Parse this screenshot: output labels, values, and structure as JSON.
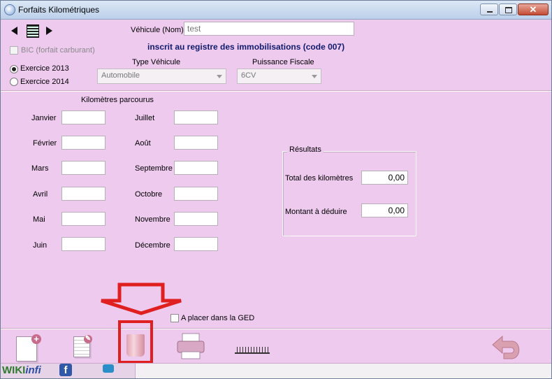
{
  "window": {
    "title": "Forfaits Kilométriques",
    "min_glyph": "",
    "max_glyph": "",
    "close_glyph": "✕"
  },
  "vehicule": {
    "label": "Véhicule (Nom)",
    "value": "test",
    "registry_text": "inscrit au registre des immobilisations (code 007)"
  },
  "options": {
    "bic_label": "BIC (forfait carburant)",
    "bic_checked": false,
    "exercices": [
      {
        "label": "Exercice 2013",
        "selected": true
      },
      {
        "label": "Exercice 2014",
        "selected": false
      }
    ]
  },
  "type_vehicule": {
    "label": "Type Véhicule",
    "value": "Automobile"
  },
  "puissance": {
    "label": "Puissance Fiscale",
    "value": "6CV"
  },
  "kilometres": {
    "section_label": "Kilomètres parcourus",
    "months_left": [
      "Janvier",
      "Février",
      "Mars",
      "Avril",
      "Mai",
      "Juin"
    ],
    "months_right": [
      "Juillet",
      "Août",
      "Septembre",
      "Octobre",
      "Novembre",
      "Décembre"
    ]
  },
  "resultats": {
    "title": "Résultats",
    "total_label": "Total des kilomètres",
    "total_value": "0,00",
    "montant_label": "Montant à déduire",
    "montant_value": "0,00"
  },
  "ged": {
    "label": "A placer dans la GED",
    "checked": false
  },
  "statusbar": {
    "wiki_a": "WIKI",
    "wiki_b": "infi",
    "fb": "f"
  },
  "colors": {
    "background": "#eecaee",
    "highlight": "#e02020",
    "registry_text": "#101a6e"
  }
}
